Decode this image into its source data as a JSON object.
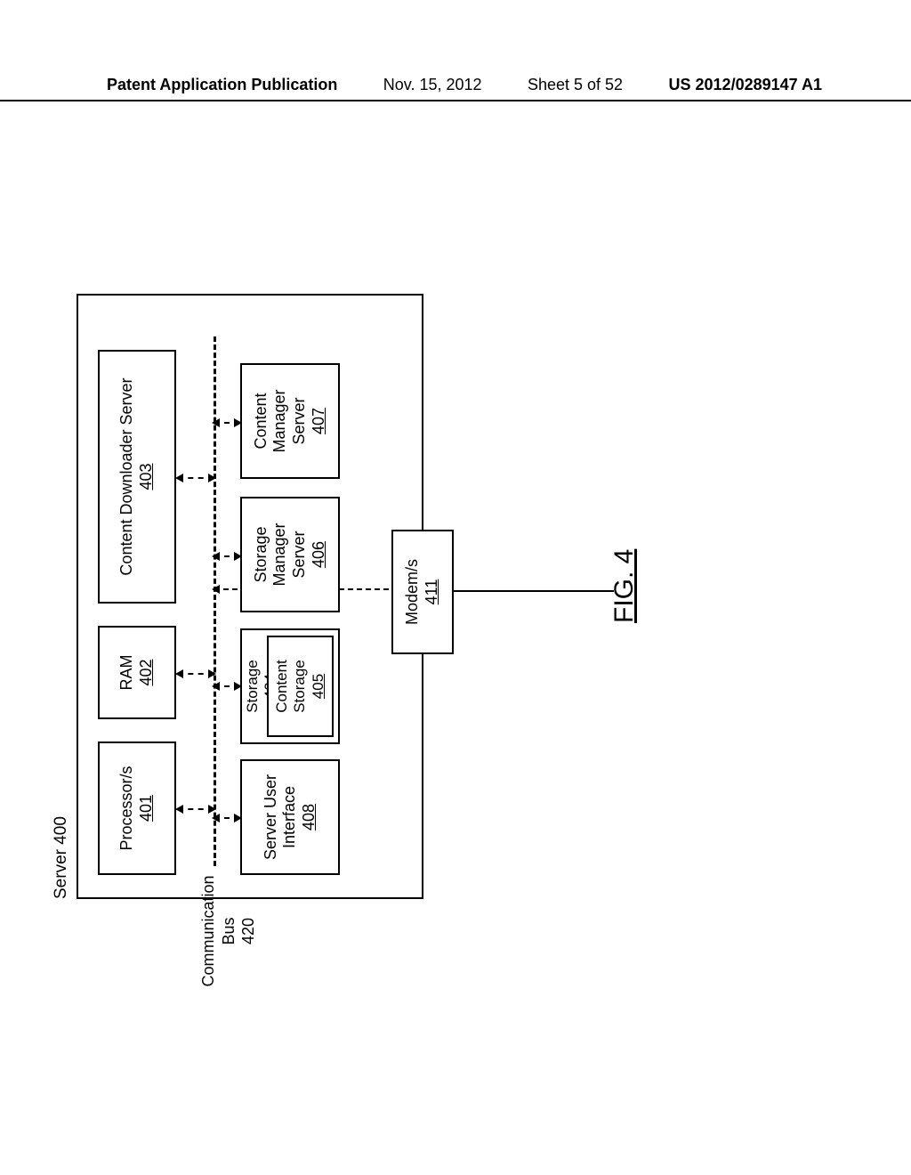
{
  "header": {
    "publication_label": "Patent Application Publication",
    "date": "Nov. 15, 2012",
    "sheet": "Sheet 5 of 52",
    "pub_number": "US 2012/0289147 A1"
  },
  "figure_label": "FIG. 4",
  "server": {
    "title": "Server 400",
    "bus_label": "Communication Bus",
    "bus_ref": "420",
    "blocks": {
      "processor": {
        "label": "Processor/s",
        "ref": "401"
      },
      "ram": {
        "label": "RAM",
        "ref": "402"
      },
      "cds": {
        "label": "Content Downloader Server",
        "ref": "403"
      },
      "sui": {
        "label": "Server User Interface",
        "ref": "408"
      },
      "storage": {
        "label": "Storage",
        "ref": "404"
      },
      "content_storage": {
        "label": "Content Storage",
        "ref": "405"
      },
      "sms": {
        "label": "Storage Manager Server",
        "ref": "406"
      },
      "cms": {
        "label": "Content Manager Server",
        "ref": "407"
      },
      "modem": {
        "label": "Modem/s",
        "ref": "411"
      }
    }
  }
}
